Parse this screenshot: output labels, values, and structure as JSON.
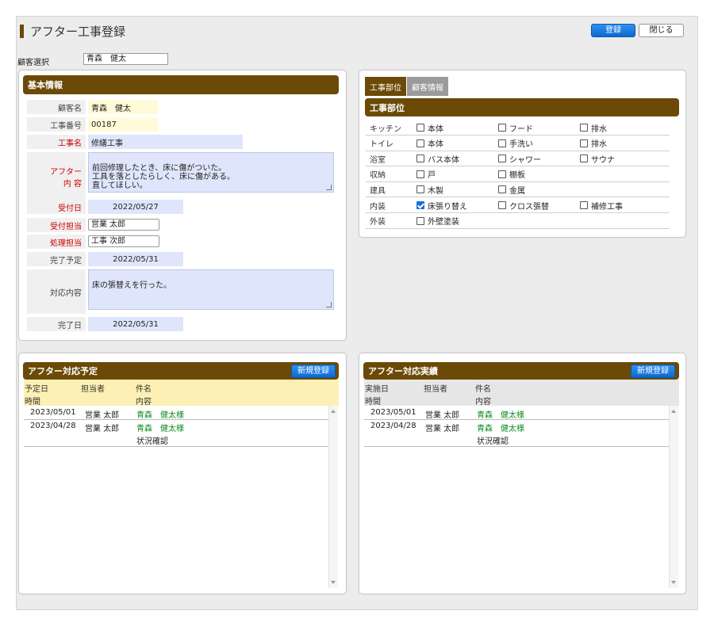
{
  "page": {
    "title": "アフター工事登録",
    "register_button": "登録",
    "close_button": "閉じる"
  },
  "customer_select": {
    "label": "顧客選択",
    "value": "青森　健太"
  },
  "basic_info": {
    "header": "基本情報",
    "customer_name_label": "顧客名",
    "customer_name": "青森　健太",
    "work_no_label": "工事番号",
    "work_no": "00187",
    "work_name_label": "工事名",
    "work_name": "修繕工事",
    "after_content_label_1": "アフター",
    "after_content_label_2": "内 容",
    "after_content": "前回修理したとき、床に傷がついた。\n工具を落としたらしく、床に傷がある。\n直してほしい。",
    "received_date_label": "受付日",
    "received_date": "2022/05/27",
    "receiver_label": "受付担当",
    "receiver": "営業 太郎",
    "handler_label": "処理担当",
    "handler": "工事 次郎",
    "planned_date_label": "完了予定",
    "planned_date": "2022/05/31",
    "response_label": "対応内容",
    "response": "床の張替えを行った。",
    "completed_label": "完了日",
    "completed_date": "2022/05/31"
  },
  "work_area": {
    "tab_active": "工事部位",
    "tab_inactive": "顧客情報",
    "header": "工事部位",
    "rows": [
      {
        "name": "キッチン",
        "items": [
          {
            "label": "本体",
            "checked": false
          },
          {
            "label": "フード",
            "checked": false
          },
          {
            "label": "排水",
            "checked": false
          }
        ]
      },
      {
        "name": "トイレ",
        "items": [
          {
            "label": "本体",
            "checked": false
          },
          {
            "label": "手洗い",
            "checked": false
          },
          {
            "label": "排水",
            "checked": false
          }
        ]
      },
      {
        "name": "浴室",
        "items": [
          {
            "label": "バス本体",
            "checked": false
          },
          {
            "label": "シャワー",
            "checked": false
          },
          {
            "label": "サウナ",
            "checked": false
          }
        ]
      },
      {
        "name": "収納",
        "items": [
          {
            "label": "戸",
            "checked": false
          },
          {
            "label": "棚板",
            "checked": false
          }
        ]
      },
      {
        "name": "建具",
        "items": [
          {
            "label": "木製",
            "checked": false
          },
          {
            "label": "金属",
            "checked": false
          }
        ]
      },
      {
        "name": "内装",
        "items": [
          {
            "label": "床張り替え",
            "checked": true
          },
          {
            "label": "クロス張替",
            "checked": false
          },
          {
            "label": "補修工事",
            "checked": false
          }
        ]
      },
      {
        "name": "外装",
        "items": [
          {
            "label": "外壁塗装",
            "checked": false
          }
        ]
      }
    ]
  },
  "schedule": {
    "header": "アフター対応予定",
    "new_button": "新規登録",
    "col_date": "予定日",
    "col_time": "時間",
    "col_staff": "担当者",
    "col_subject": "件名",
    "col_content": "内容",
    "rows": [
      {
        "date": "2023/05/01",
        "staff": "営業 太郎",
        "subject": "青森　健太様",
        "content": ""
      },
      {
        "date": "2023/04/28",
        "staff": "営業 太郎",
        "subject": "青森　健太様",
        "content": "状況確認"
      }
    ]
  },
  "results": {
    "header": "アフター対応実績",
    "new_button": "新規登録",
    "col_date": "実施日",
    "col_time": "時間",
    "col_staff": "担当者",
    "col_subject": "件名",
    "col_content": "内容",
    "rows": [
      {
        "date": "2023/05/01",
        "staff": "営業 太郎",
        "subject": "青森　健太様",
        "content": ""
      },
      {
        "date": "2023/04/28",
        "staff": "営業 太郎",
        "subject": "青森　健太様",
        "content": "状況確認"
      }
    ]
  },
  "colors": {
    "brown_header": "#6b4a07",
    "accent_blue": "#0d6ad1",
    "required_red": "#cc0000",
    "link_green": "#0a8a1f"
  }
}
